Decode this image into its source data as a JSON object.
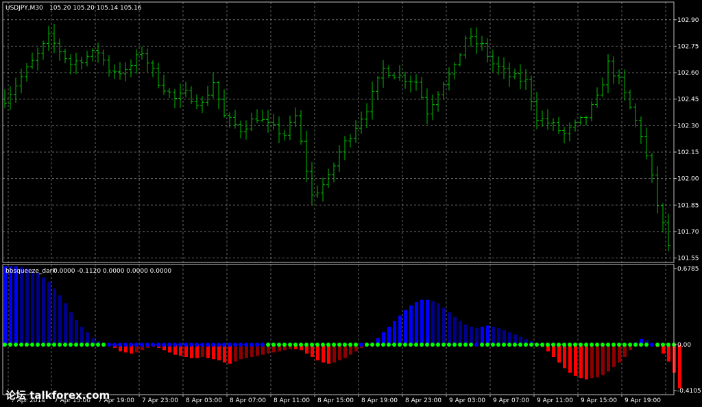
{
  "theme": {
    "background": "#000000",
    "frame": "#c0c0c0",
    "grid": "#c0c0c0",
    "text": "#ffffff",
    "candle": "#00c000",
    "bull_strong": "#0000ff",
    "bull_weak": "#00008b",
    "bear_strong": "#ff0000",
    "bear_weak": "#8b0000",
    "squeeze_dot": "#00ff00",
    "release_dot": "#0000ff"
  },
  "watermark": "论坛 talkforex.com",
  "chart_data": [
    {
      "type": "ohlc",
      "title": "USDJPY,M30",
      "ohlc_readout": "105.20 105.20 105.14 105.16",
      "y_ticks": [
        102.9,
        102.75,
        102.6,
        102.45,
        102.3,
        102.15,
        102.0,
        101.85,
        101.7,
        101.55
      ],
      "y_tick_labels": [
        "102.90",
        "102.75",
        "102.60",
        "102.45",
        "102.30",
        "102.15",
        "102.00",
        "101.85",
        "101.70",
        "101.55"
      ],
      "ylim": [
        101.525,
        103.0
      ],
      "bars": 122,
      "path_points": [
        [
          0,
          102.45
        ],
        [
          6,
          102.7
        ],
        [
          8,
          102.8
        ],
        [
          12,
          102.65
        ],
        [
          17,
          102.72
        ],
        [
          19,
          102.62
        ],
        [
          22,
          102.6
        ],
        [
          25,
          102.72
        ],
        [
          28,
          102.55
        ],
        [
          31,
          102.45
        ],
        [
          33,
          102.48
        ],
        [
          36,
          102.42
        ],
        [
          38,
          102.55
        ],
        [
          40,
          102.35
        ],
        [
          43,
          102.28
        ],
        [
          46,
          102.35
        ],
        [
          48,
          102.3
        ],
        [
          51,
          102.25
        ],
        [
          53,
          102.35
        ],
        [
          56,
          101.9
        ],
        [
          59,
          102.0
        ],
        [
          61,
          102.15
        ],
        [
          63,
          102.25
        ],
        [
          66,
          102.4
        ],
        [
          69,
          102.62
        ],
        [
          72,
          102.58
        ],
        [
          75,
          102.55
        ],
        [
          77,
          102.38
        ],
        [
          80,
          102.55
        ],
        [
          82,
          102.62
        ],
        [
          84,
          102.8
        ],
        [
          87,
          102.75
        ],
        [
          89,
          102.65
        ],
        [
          92,
          102.58
        ],
        [
          95,
          102.55
        ],
        [
          97,
          102.35
        ],
        [
          100,
          102.3
        ],
        [
          102,
          102.25
        ],
        [
          104,
          102.3
        ],
        [
          106,
          102.35
        ],
        [
          108,
          102.45
        ],
        [
          110,
          102.65
        ],
        [
          112,
          102.55
        ],
        [
          114,
          102.4
        ],
        [
          116,
          102.25
        ],
        [
          118,
          102.0
        ],
        [
          119,
          101.85
        ],
        [
          121,
          101.62
        ]
      ]
    },
    {
      "type": "histogram",
      "title": "bbsqueeze_dark",
      "value_readout": "0.0000 -0.1120 0.0000 0.0000 0.0000",
      "y_ticks": [
        0.6785,
        0.0,
        -0.4105
      ],
      "y_tick_labels": [
        "0.6785",
        "0.00",
        "-0.4105"
      ],
      "ylim": [
        -0.4105,
        0.6785
      ],
      "x_tick_labels": [
        "7 Apr 2014",
        "7 Apr 15:00",
        "7 Apr 19:00",
        "7 Apr 23:00",
        "8 Apr 03:00",
        "8 Apr 07:00",
        "8 Apr 11:00",
        "8 Apr 15:00",
        "8 Apr 19:00",
        "8 Apr 23:00",
        "9 Apr 03:00",
        "9 Apr 07:00",
        "9 Apr 11:00",
        "9 Apr 15:00",
        "9 Apr 19:00"
      ],
      "values": [
        0.7,
        0.7,
        0.7,
        0.69,
        0.68,
        0.66,
        0.64,
        0.6,
        0.56,
        0.5,
        0.44,
        0.37,
        0.29,
        0.22,
        0.16,
        0.11,
        0.06,
        0.03,
        0.01,
        0.0,
        -0.03,
        -0.06,
        -0.07,
        -0.08,
        -0.07,
        -0.05,
        -0.03,
        -0.02,
        -0.03,
        -0.05,
        -0.07,
        -0.09,
        -0.1,
        -0.11,
        -0.12,
        -0.12,
        -0.11,
        -0.12,
        -0.13,
        -0.14,
        -0.16,
        -0.17,
        -0.15,
        -0.13,
        -0.12,
        -0.11,
        -0.1,
        -0.09,
        -0.08,
        -0.07,
        -0.06,
        -0.05,
        -0.04,
        -0.04,
        -0.05,
        -0.08,
        -0.11,
        -0.14,
        -0.16,
        -0.17,
        -0.16,
        -0.14,
        -0.12,
        -0.09,
        -0.06,
        -0.03,
        -0.01,
        0.02,
        0.06,
        0.11,
        0.16,
        0.21,
        0.26,
        0.31,
        0.35,
        0.38,
        0.4,
        0.4,
        0.39,
        0.37,
        0.33,
        0.29,
        0.25,
        0.21,
        0.18,
        0.16,
        0.15,
        0.16,
        0.17,
        0.16,
        0.15,
        0.13,
        0.11,
        0.09,
        0.07,
        0.05,
        0.03,
        0.01,
        -0.02,
        -0.06,
        -0.11,
        -0.16,
        -0.21,
        -0.25,
        -0.28,
        -0.3,
        -0.31,
        -0.3,
        -0.29,
        -0.27,
        -0.24,
        -0.2,
        -0.16,
        -0.11,
        -0.05,
        0.02,
        0.05,
        0.04,
        0.01,
        -0.02,
        -0.08,
        -0.15,
        -0.25,
        -0.39
      ],
      "squeeze_on": [
        true,
        true,
        true,
        true,
        true,
        true,
        true,
        true,
        true,
        true,
        true,
        true,
        true,
        true,
        true,
        true,
        true,
        true,
        true,
        false,
        false,
        false,
        false,
        false,
        false,
        false,
        false,
        false,
        false,
        false,
        false,
        false,
        false,
        false,
        false,
        false,
        false,
        false,
        false,
        false,
        false,
        false,
        false,
        false,
        false,
        false,
        false,
        false,
        true,
        true,
        true,
        true,
        true,
        true,
        true,
        true,
        true,
        true,
        true,
        true,
        true,
        true,
        true,
        true,
        true,
        false,
        true,
        true,
        true,
        true,
        true,
        true,
        true,
        true,
        true,
        true,
        true,
        true,
        true,
        true,
        true,
        true,
        true,
        true,
        true,
        true,
        false,
        true,
        true,
        true,
        true,
        true,
        true,
        true,
        true,
        true,
        true,
        true,
        true,
        true,
        true,
        true,
        true,
        true,
        true,
        true,
        true,
        true,
        true,
        true,
        true,
        true,
        true,
        true,
        true,
        true,
        true,
        true,
        false,
        true,
        true,
        true,
        true
      ]
    }
  ]
}
